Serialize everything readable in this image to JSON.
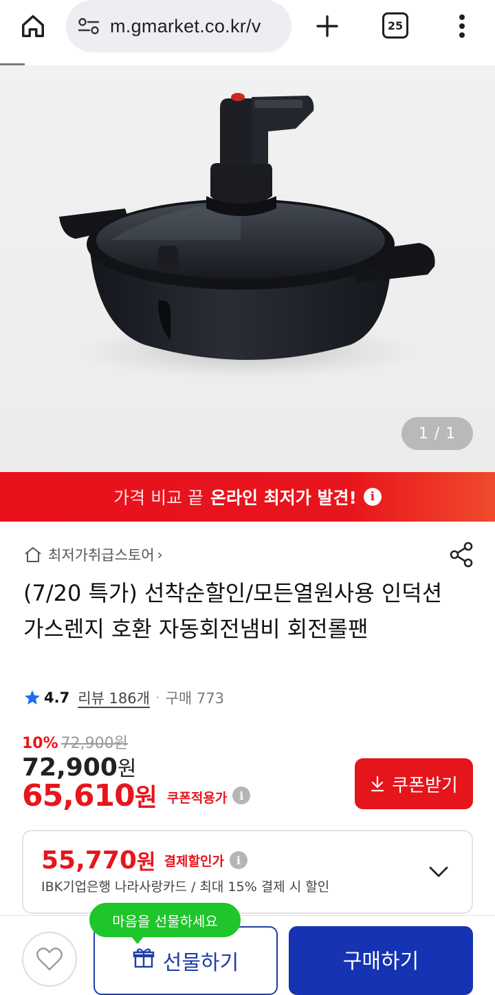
{
  "browser": {
    "url": "m.gmarket.co.kr/v",
    "tab_count": "25",
    "icons": [
      "home-icon",
      "tune-icon",
      "plus-icon",
      "tabs-icon",
      "more-vert-icon"
    ]
  },
  "gallery": {
    "counter": "1 / 1"
  },
  "promo_banner": {
    "light_text": "가격 비교 끝",
    "strong_text": "온라인 최저가 발견!",
    "info_glyph": "i",
    "background": "#e8111c"
  },
  "store": {
    "name": "최저가취급스토어",
    "chevron": "›"
  },
  "product": {
    "title": "(7/20 특가) 선착순할인/모든열원사용 인덕션 가스렌지 호환 자동회전냄비 회전롤팬",
    "rating": "4.7",
    "review_label": "리뷰 186개",
    "dot": "·",
    "purchase_label": "구매 773"
  },
  "pricing": {
    "discount_rate": "10%",
    "list_price_strike": "72,900원",
    "original_price": "72,900",
    "original_currency": "원",
    "coupon_price": "65,610",
    "coupon_currency": "원",
    "coupon_tag": "쿠폰적용가",
    "coupon_button": "쿠폰받기",
    "accent": "#e8151c"
  },
  "payment": {
    "price": "55,770",
    "currency": "원",
    "tag": "결제할인가",
    "description": "IBK기업은행 나라사랑카드 / 최대 15% 결제 시 할인"
  },
  "bottom_bar": {
    "tooltip": "마음을 선물하세요",
    "gift_label": "선물하기",
    "buy_label": "구매하기",
    "buy_color": "#1533b3",
    "tooltip_color": "#1ec52b"
  },
  "info_glyph": "i"
}
